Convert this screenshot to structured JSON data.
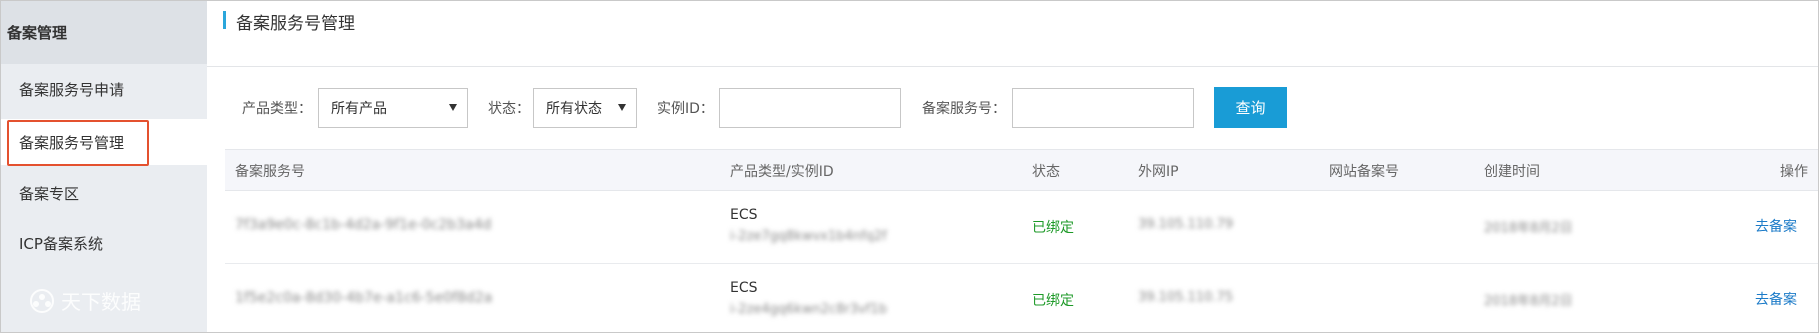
{
  "sidebar": {
    "header": "备案管理",
    "items": [
      {
        "label": "备案服务号申请"
      },
      {
        "label": "备案服务号管理"
      },
      {
        "label": "备案专区"
      },
      {
        "label": "ICP备案系统"
      }
    ],
    "watermark": "天下数据"
  },
  "page": {
    "title": "备案服务号管理"
  },
  "filters": {
    "product_type_label": "产品类型：",
    "product_type_value": "所有产品",
    "status_label": "状态：",
    "status_value": "所有状态",
    "instance_id_label": "实例ID：",
    "instance_id_value": "",
    "service_no_label": "备案服务号：",
    "service_no_value": "",
    "query_button": "查询"
  },
  "table": {
    "columns": {
      "service_no": "备案服务号",
      "product_instance": "产品类型/实例ID",
      "status": "状态",
      "public_ip": "外网IP",
      "site_record_no": "网站备案号",
      "created_at": "创建时间",
      "actions": "操作"
    },
    "rows": [
      {
        "service_no": "7f3a9e0c-8c1b-4d2a-9f1e-0c2b3a4d",
        "product": "ECS",
        "instance_id": "i-2ze7gq8kwvx1b4nfq2f",
        "status": "已绑定",
        "public_ip": "39.105.110.79",
        "site_record_no": "",
        "created_at": "2018年8月2日",
        "action": "去备案"
      },
      {
        "service_no": "1f5e2c0a-8d30-4b7e-a1c6-5e0f8d2a",
        "product": "ECS",
        "instance_id": "i-2ze4gq6kwn2c8r3vf1b",
        "status": "已绑定",
        "public_ip": "39.105.110.75",
        "site_record_no": "",
        "created_at": "2018年8月2日",
        "action": "去备案"
      }
    ]
  },
  "colors": {
    "accent": "#199cd6",
    "highlight": "#e4512f",
    "status_bound": "#1e9a28",
    "link": "#1c7bc8"
  }
}
